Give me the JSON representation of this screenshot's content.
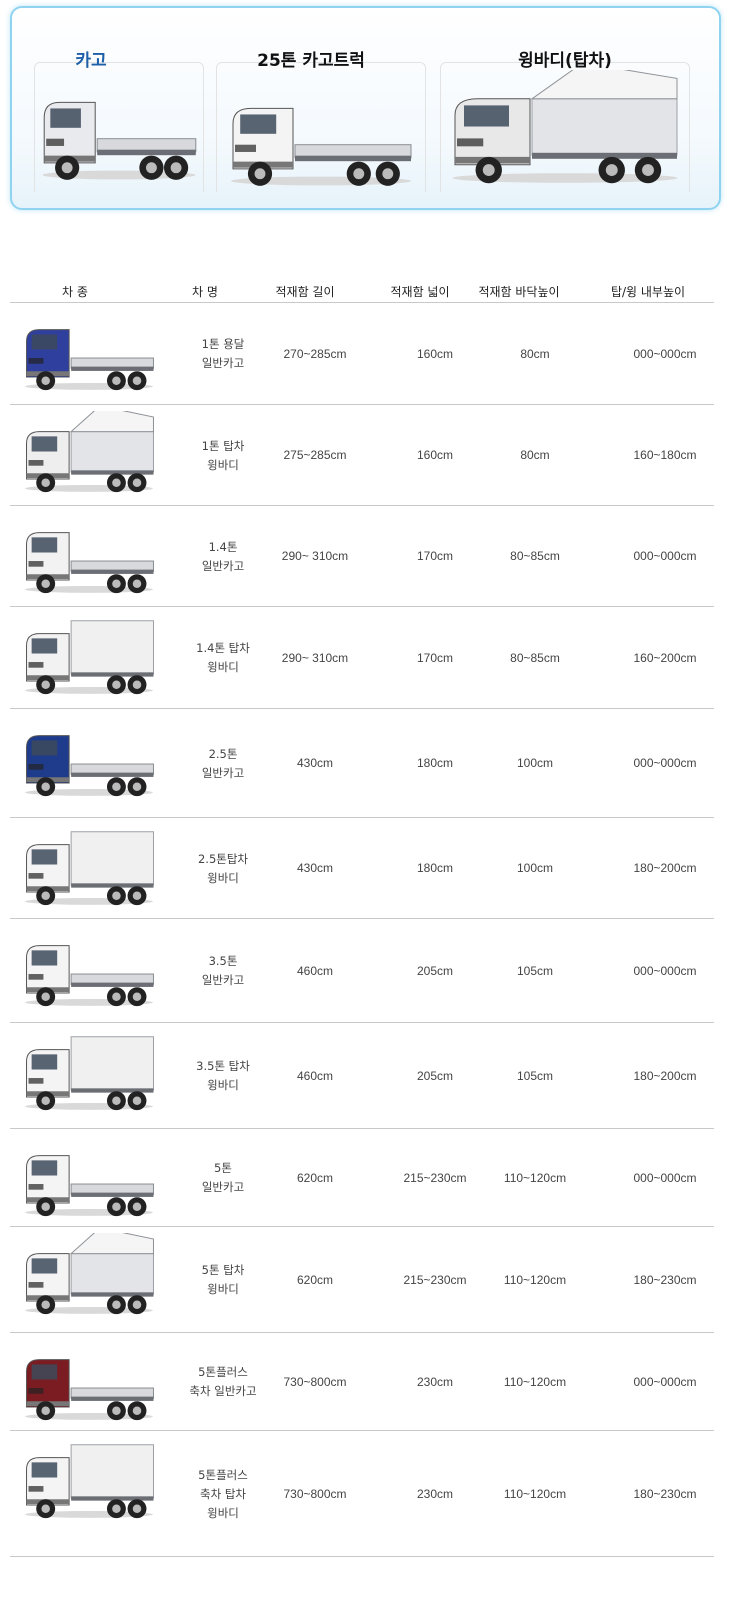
{
  "banner": {
    "cards": [
      {
        "label": "카고",
        "type": "cargo",
        "cab": "#e9eaed",
        "accent": "#c5c9cf"
      },
      {
        "label": "25톤 카고트럭",
        "type": "cargo",
        "cab": "#f4f4f4",
        "accent": "#cfd2d6"
      },
      {
        "label": "윙바디(탑차)",
        "type": "wing",
        "cab": "#e8e8e8",
        "accent": "#bfc3c8"
      }
    ]
  },
  "table": {
    "headers": [
      "차 종",
      "차 명",
      "적재함 길이",
      "적재함 넓이",
      "적재함 바닥높이",
      "탑/윙 내부높이"
    ],
    "rows": [
      {
        "name": [
          "1톤 용달",
          "일반카고"
        ],
        "length": "270~285cm",
        "width": "160cm",
        "floor": "80cm",
        "inner": "000~000cm",
        "type": "cargo",
        "cab": "#2f3f9e"
      },
      {
        "name": [
          "1톤 탑차",
          "윙바디"
        ],
        "length": "275~285cm",
        "width": "160cm",
        "floor": "80cm",
        "inner": "160~180cm",
        "type": "wing",
        "cab": "#eeeeee"
      },
      {
        "name": [
          "1.4톤",
          "일반카고"
        ],
        "length": "290~ 310cm",
        "width": "170cm",
        "floor": "80~85cm",
        "inner": "000~000cm",
        "type": "cargo",
        "cab": "#f2f2f2"
      },
      {
        "name": [
          "1.4톤 탑차",
          "윙바디"
        ],
        "length": "290~ 310cm",
        "width": "170cm",
        "floor": "80~85cm",
        "inner": "160~200cm",
        "type": "box",
        "cab": "#f2f2f2"
      },
      {
        "name": [
          "2.5톤",
          "일반카고"
        ],
        "length": "430cm",
        "width": "180cm",
        "floor": "100cm",
        "inner": "000~000cm",
        "type": "cargo",
        "cab": "#1f3c8c"
      },
      {
        "name": [
          "2.5톤탑차",
          "윙바디"
        ],
        "length": "430cm",
        "width": "180cm",
        "floor": "100cm",
        "inner": "180~200cm",
        "type": "box",
        "cab": "#f4f4f4"
      },
      {
        "name": [
          "3.5톤",
          "일반카고"
        ],
        "length": "460cm",
        "width": "205cm",
        "floor": "105cm",
        "inner": "000~000cm",
        "type": "cargo",
        "cab": "#f4f4f4"
      },
      {
        "name": [
          "3.5톤 탑차",
          "윙바디"
        ],
        "length": "460cm",
        "width": "205cm",
        "floor": "105cm",
        "inner": "180~200cm",
        "type": "box",
        "cab": "#f4f4f4"
      },
      {
        "name": [
          "5톤",
          "일반카고"
        ],
        "length": "620cm",
        "width": "215~230cm",
        "floor": "110~120cm",
        "inner": "000~000cm",
        "type": "cargo",
        "cab": "#f4f4f4"
      },
      {
        "name": [
          "5톤 탑차",
          "윙바디"
        ],
        "length": "620cm",
        "width": "215~230cm",
        "floor": "110~120cm",
        "inner": "180~230cm",
        "type": "wing",
        "cab": "#f4f4f4"
      },
      {
        "name": [
          "5톤플러스",
          "축차 일반카고"
        ],
        "length": "730~800cm",
        "width": "230cm",
        "floor": "110~120cm",
        "inner": "000~000cm",
        "type": "cargo",
        "cab": "#7a1c22"
      },
      {
        "name": [
          "5톤플러스",
          "축차 탑차",
          "윙바디"
        ],
        "length": "730~800cm",
        "width": "230cm",
        "floor": "110~120cm",
        "inner": "180~230cm",
        "type": "box",
        "cab": "#f4f4f4"
      }
    ]
  }
}
